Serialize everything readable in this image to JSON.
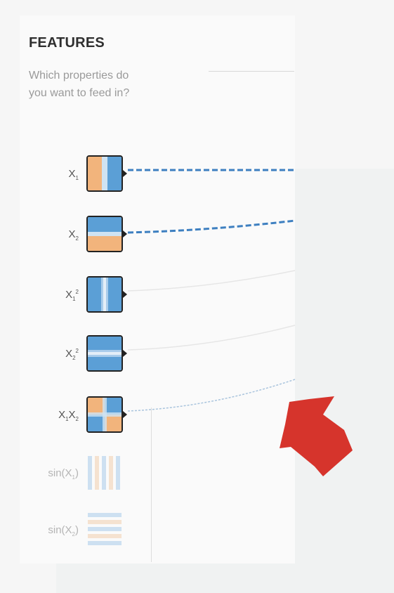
{
  "features": {
    "title": "FEATURES",
    "subtitle": "Which properties do you want to feed in?",
    "items": [
      {
        "base": "X",
        "sub": "1",
        "sup": "",
        "active": true
      },
      {
        "base": "X",
        "sub": "2",
        "sup": "",
        "active": true
      },
      {
        "base": "X",
        "sub": "1",
        "sup": "2",
        "active": true
      },
      {
        "base": "X",
        "sub": "2",
        "sup": "2",
        "active": true
      },
      {
        "base": "X",
        "sub": "1",
        "sup": "",
        "base2": "X",
        "sub2": "2",
        "active": true
      },
      {
        "prefix": "sin(X",
        "sub": "1",
        "suffix": ")",
        "active": false
      },
      {
        "prefix": "sin(X",
        "sub": "2",
        "suffix": ")",
        "active": false
      }
    ]
  },
  "colors": {
    "blue": "#5b9fd6",
    "orange": "#f2b47c",
    "light_blue": "#a9cceb",
    "arrow": "#d6342c",
    "tile_border": "#222222"
  },
  "icons": {
    "arrow": "red-arrow-icon"
  }
}
